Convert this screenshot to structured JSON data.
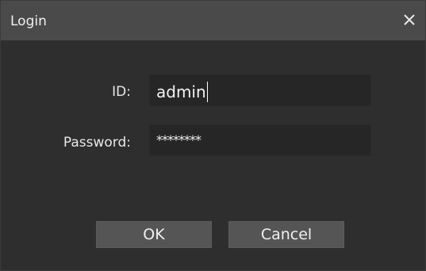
{
  "window": {
    "title": "Login",
    "close_icon": "close-icon"
  },
  "form": {
    "id_label": "ID:",
    "id_value": "admin",
    "password_label": "Password:",
    "password_value": "********"
  },
  "buttons": {
    "ok_label": "OK",
    "cancel_label": "Cancel"
  },
  "colors": {
    "titlebar": "#4a4a4a",
    "background": "#2e2e2e",
    "field": "#262626",
    "button": "#555555"
  }
}
